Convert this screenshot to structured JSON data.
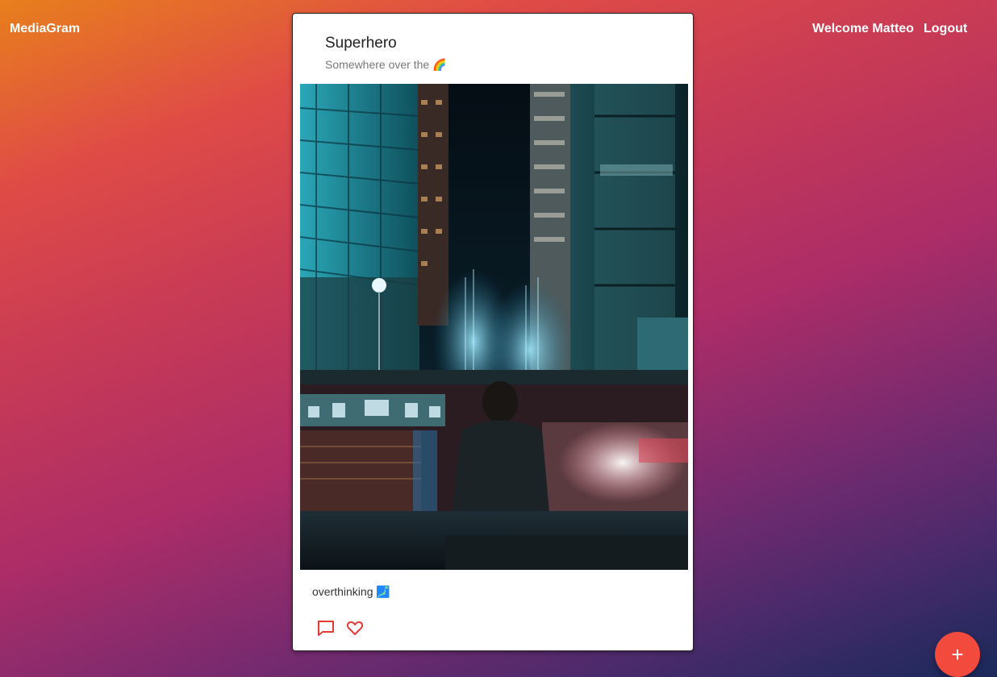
{
  "header": {
    "brand": "MediaGram",
    "welcome": "Welcome Matteo",
    "logout": "Logout"
  },
  "post": {
    "title": "Superhero",
    "subtitle": "Somewhere over the 🌈",
    "caption": "overthinking 🗾"
  },
  "fab": {
    "label": "+"
  },
  "colors": {
    "accent": "#f24a3c",
    "icon": "#e53935"
  }
}
